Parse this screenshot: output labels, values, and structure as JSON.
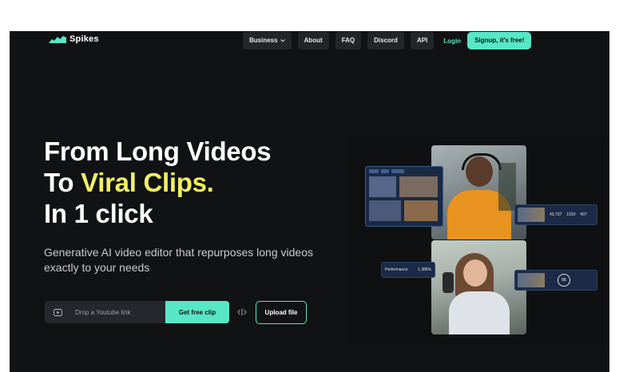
{
  "header": {
    "logo_text": "Spikes",
    "nav": [
      {
        "label": "Business",
        "has_dropdown": true
      },
      {
        "label": "About"
      },
      {
        "label": "FAQ"
      },
      {
        "label": "Discord"
      },
      {
        "label": "API"
      }
    ],
    "login_label": "Login",
    "signup_label": "Signup, it's free!"
  },
  "hero": {
    "line1": "From Long Videos",
    "line2_prefix": "To ",
    "line2_accent": "Viral Clips.",
    "line3": "In 1 click",
    "subtitle": "Generative AI video editor that repurposes long videos exactly to your needs"
  },
  "actions": {
    "input_placeholder": "Drop a Youtube link",
    "get_clip_label": "Get free clip",
    "upload_label": "Upload file"
  },
  "collage": {
    "perf_label": "Performance",
    "perf_value": "1.386%",
    "stat_values": [
      "43,737",
      "1910",
      "407"
    ],
    "score_value": "66"
  },
  "colors": {
    "background": "#101214",
    "accent_green": "#57e7c6",
    "accent_yellow": "#f2f060"
  }
}
